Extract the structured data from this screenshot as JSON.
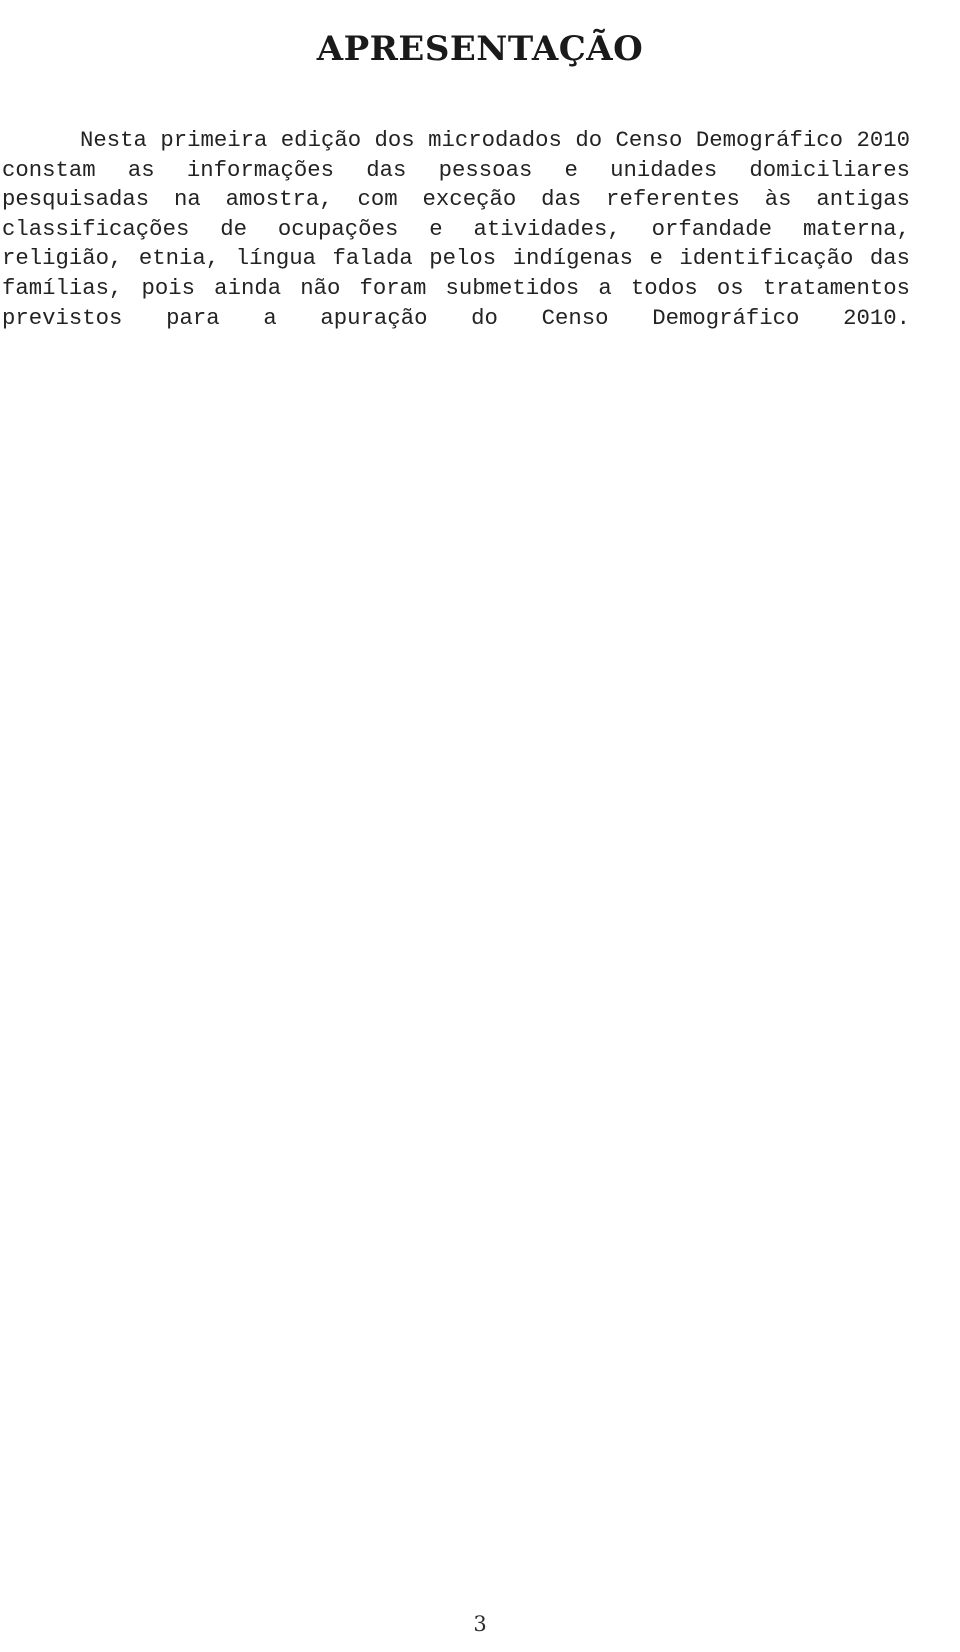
{
  "document": {
    "title": "APRESENTAÇÃO",
    "page_number": "3",
    "body_paragraph": "Nesta primeira edição dos microdados do Censo Demográfico 2010 constam as informações das pessoas e unidades domiciliares pesquisadas na amostra, com exceção das referentes às antigas classificações de ocupações e atividades, orfandade materna, religião, etnia, língua falada pelos indígenas e identificação das famílias, pois ainda não foram submetidos a todos os tratamentos previstos para a apuração do Censo Demográfico 2010.",
    "lines": [
      "Nesta primeira edição dos microdados do Censo",
      "Demográfico 2010 constam as informações das pessoas e",
      "unidades domiciliares pesquisadas na amostra, com exceção",
      "das referentes às antigas classificações de ocupações e",
      "atividades, orfandade materna, religião, etnia, língua",
      "falada pelos indígenas e identificação das famílias, pois",
      "ainda não foram submetidos a todos os tratamentos previstos",
      "para a apuração do Censo Demográfico 2010."
    ],
    "colors": {
      "text": "#232323",
      "title": "#1a1a1a",
      "background": "#ffffff"
    }
  }
}
